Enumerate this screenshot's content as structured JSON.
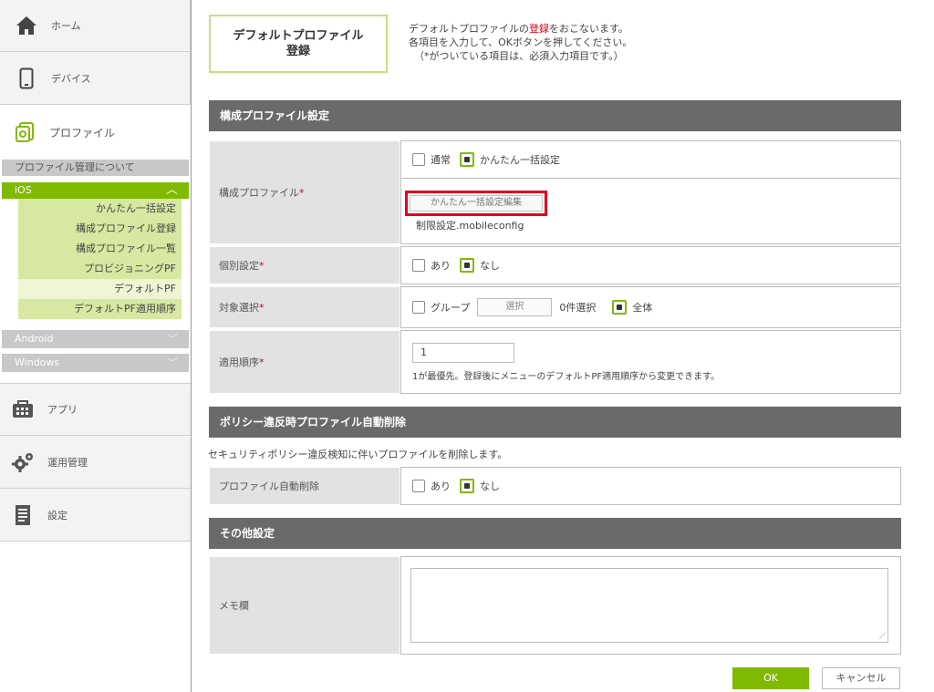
{
  "sidebar": {
    "home": {
      "label": "ホーム",
      "icon": "home-icon"
    },
    "device": {
      "label": "デバイス",
      "icon": "phone-icon"
    },
    "profile": {
      "label": "プロファイル",
      "icon": "profile-icon"
    },
    "about": "プロファイル管理について",
    "ios": {
      "label": "iOS",
      "items": [
        "かんたん一括設定",
        "構成プロファイル登録",
        "構成プロファイル一覧",
        "プロビジョニングPF",
        "デフォルトPF",
        "デフォルトPF適用順序"
      ]
    },
    "android": "Android",
    "windows": "Windows",
    "app": {
      "label": "アプリ",
      "icon": "app-icon"
    },
    "ops": {
      "label": "運用管理",
      "icon": "gear-icon"
    },
    "settings": {
      "label": "設定",
      "icon": "document-icon"
    }
  },
  "header": {
    "title": "デフォルトプロファイル登録",
    "title_line1": "デフォルトプロファイル",
    "title_line2": "登録",
    "intro_line1_pre": "デフォルトプロファイルの",
    "intro_line1_red": "登録",
    "intro_line1_post": "をおこないます。",
    "intro_line2": "各項目を入力して、OKボタンを押してください。",
    "intro_line3": "（*がついている項目は、必須入力項目です。）"
  },
  "sections": {
    "config": "構成プロファイル設定",
    "policy": "ポリシー違反時プロファイル自動削除",
    "other": "その他設定"
  },
  "form": {
    "config_profile_label": "構成プロファイル",
    "option_normal": "通常",
    "option_easy": "かんたん一括設定",
    "edit_button": "かんたん一括設定編集",
    "config_file": "制限設定.mobileconfig",
    "individual_label": "個別設定",
    "yes": "あり",
    "no": "なし",
    "target_label": "対象選択",
    "group": "グループ",
    "select_button": "選択",
    "selected_count": "0件選択",
    "all": "全体",
    "order_label": "適用順序",
    "order_value": "1",
    "order_note": "1が最優先。登録後にメニューのデフォルトPF適用順序から変更できます。",
    "policy_note": "セキュリティポリシー違反検知に伴いプロファイルを削除します。",
    "auto_delete_label": "プロファイル自動削除",
    "memo_label": "メモ欄",
    "required_mark": "*"
  },
  "buttons": {
    "ok": "OK",
    "cancel": "キャンセル"
  },
  "colors": {
    "accent": "#7fba00",
    "highlight": "#e0001b",
    "section": "#6a6a6a"
  }
}
